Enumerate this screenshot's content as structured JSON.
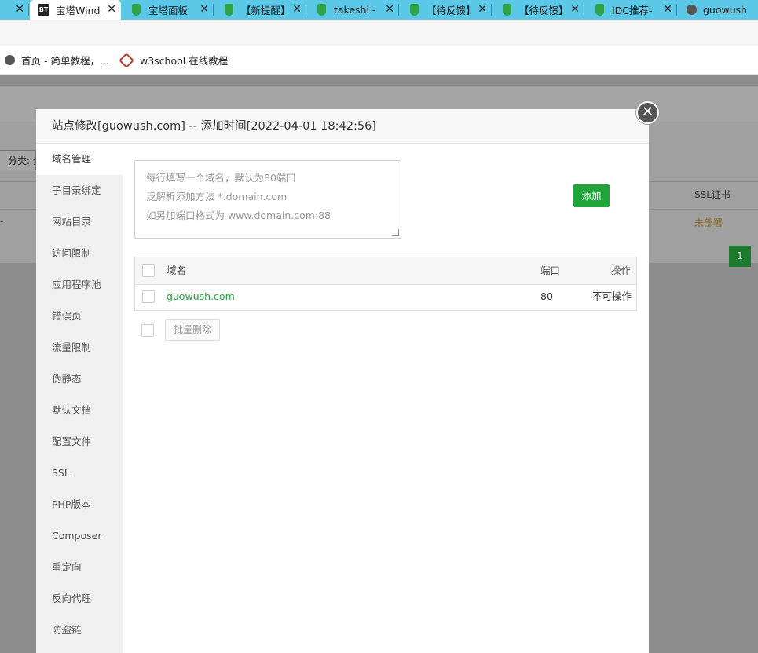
{
  "browser": {
    "tabs": [
      {
        "title": "",
        "favicon": "none",
        "active": false
      },
      {
        "title": "宝塔Windo",
        "favicon": "bt-logo-icon",
        "active": true
      },
      {
        "title": "宝塔面板",
        "favicon": "shield-icon",
        "active": false
      },
      {
        "title": "【新提醒】",
        "favicon": "shield-icon",
        "active": false
      },
      {
        "title": "takeshi -",
        "favicon": "shield-icon",
        "active": false
      },
      {
        "title": "【待反馈】",
        "favicon": "shield-icon",
        "active": false
      },
      {
        "title": "【待反馈】",
        "favicon": "shield-icon",
        "active": false
      },
      {
        "title": "IDC推荐-",
        "favicon": "shield-icon",
        "active": false
      },
      {
        "title": "guowush",
        "favicon": "globe-icon",
        "active": false
      }
    ],
    "favicon_bt_text": "BT",
    "close_glyph": "✕",
    "bookmarks": [
      {
        "label": "首页 - 简单教程，...",
        "icon": "globe-icon"
      },
      {
        "label": "w3school 在线教程",
        "icon": "w3school-icon"
      }
    ]
  },
  "background_page": {
    "filter_label": "分类: 全",
    "ssl_header": "SSL证书",
    "ssl_value": "未部署",
    "dash": "-",
    "page_number": "1"
  },
  "modal": {
    "title": "站点修改[guowush.com] -- 添加时间[2022-04-01 18:42:56]",
    "close_glyph": "✕",
    "nav_items": [
      "域名管理",
      "子目录绑定",
      "网站目录",
      "访问限制",
      "应用程序池",
      "错误页",
      "流量限制",
      "伪静态",
      "默认文档",
      "配置文件",
      "SSL",
      "PHP版本",
      "Composer",
      "重定向",
      "反向代理",
      "防盗链"
    ],
    "active_nav": 0,
    "textarea_placeholder_lines": [
      "每行填写一个域名，默认为80端口",
      "泛解析添加方法 *.domain.com",
      "如另加端口格式为 www.domain.com:88"
    ],
    "add_button": "添加",
    "table": {
      "headers": {
        "domain": "域名",
        "port": "端口",
        "action": "操作"
      },
      "rows": [
        {
          "domain": "guowush.com",
          "port": "80",
          "action": "不可操作"
        }
      ]
    },
    "bulk_delete_button": "批量删除",
    "colors": {
      "accent_green": "#20a53a",
      "tab_strip": "#5bc8e8"
    }
  }
}
